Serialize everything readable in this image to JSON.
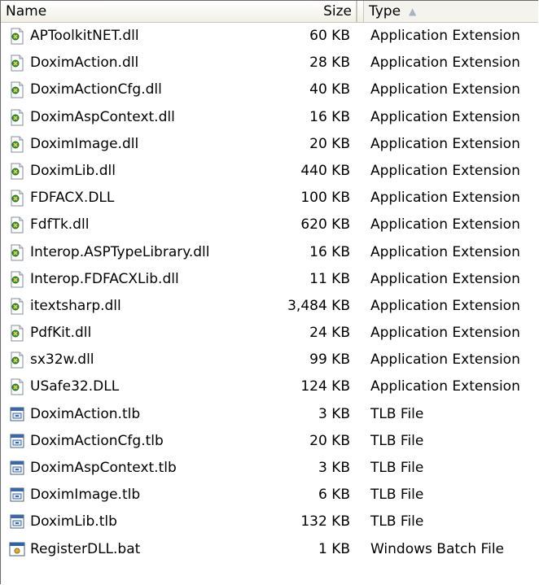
{
  "columns": {
    "name": "Name",
    "size": "Size",
    "type": "Type"
  },
  "sort": {
    "column": "type",
    "direction": "ascending",
    "icon": "sort-up-arrow-icon"
  },
  "files": [
    {
      "name": "APToolkitNET.dll",
      "size": "60 KB",
      "type": "Application Extension",
      "icon": "dll-icon"
    },
    {
      "name": "DoximAction.dll",
      "size": "28 KB",
      "type": "Application Extension",
      "icon": "dll-icon"
    },
    {
      "name": "DoximActionCfg.dll",
      "size": "40 KB",
      "type": "Application Extension",
      "icon": "dll-icon"
    },
    {
      "name": "DoximAspContext.dll",
      "size": "16 KB",
      "type": "Application Extension",
      "icon": "dll-icon"
    },
    {
      "name": "DoximImage.dll",
      "size": "20 KB",
      "type": "Application Extension",
      "icon": "dll-icon"
    },
    {
      "name": "DoximLib.dll",
      "size": "440 KB",
      "type": "Application Extension",
      "icon": "dll-icon"
    },
    {
      "name": "FDFACX.DLL",
      "size": "100 KB",
      "type": "Application Extension",
      "icon": "dll-icon"
    },
    {
      "name": "FdfTk.dll",
      "size": "620 KB",
      "type": "Application Extension",
      "icon": "dll-icon"
    },
    {
      "name": "Interop.ASPTypeLibrary.dll",
      "size": "16 KB",
      "type": "Application Extension",
      "icon": "dll-icon"
    },
    {
      "name": "Interop.FDFACXLib.dll",
      "size": "11 KB",
      "type": "Application Extension",
      "icon": "dll-icon"
    },
    {
      "name": "itextsharp.dll",
      "size": "3,484 KB",
      "type": "Application Extension",
      "icon": "dll-icon"
    },
    {
      "name": "PdfKit.dll",
      "size": "24 KB",
      "type": "Application Extension",
      "icon": "dll-icon"
    },
    {
      "name": "sx32w.dll",
      "size": "99 KB",
      "type": "Application Extension",
      "icon": "dll-icon"
    },
    {
      "name": "USafe32.DLL",
      "size": "124 KB",
      "type": "Application Extension",
      "icon": "dll-icon"
    },
    {
      "name": "DoximAction.tlb",
      "size": "3 KB",
      "type": "TLB File",
      "icon": "tlb-icon"
    },
    {
      "name": "DoximActionCfg.tlb",
      "size": "20 KB",
      "type": "TLB File",
      "icon": "tlb-icon"
    },
    {
      "name": "DoximAspContext.tlb",
      "size": "3 KB",
      "type": "TLB File",
      "icon": "tlb-icon"
    },
    {
      "name": "DoximImage.tlb",
      "size": "6 KB",
      "type": "TLB File",
      "icon": "tlb-icon"
    },
    {
      "name": "DoximLib.tlb",
      "size": "132 KB",
      "type": "TLB File",
      "icon": "tlb-icon"
    },
    {
      "name": "RegisterDLL.bat",
      "size": "1 KB",
      "type": "Windows Batch File",
      "icon": "bat-icon"
    }
  ]
}
